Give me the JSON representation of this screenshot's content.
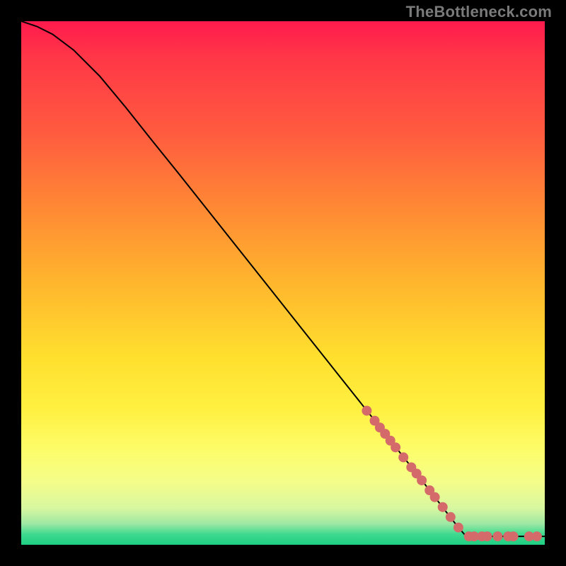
{
  "watermark": "TheBottleneck.com",
  "chart_data": {
    "type": "line",
    "title": "",
    "xlabel": "",
    "ylabel": "",
    "xlim": [
      0,
      100
    ],
    "ylim": [
      0,
      100
    ],
    "grid": false,
    "series": [
      {
        "name": "curve",
        "x": [
          0,
          3,
          6,
          10,
          15,
          20,
          25,
          30,
          35,
          40,
          45,
          50,
          55,
          60,
          65,
          70,
          74,
          78,
          81,
          83.5,
          85,
          90,
          95,
          100
        ],
        "y": [
          100,
          99,
          97.5,
          94.5,
          89.5,
          83.5,
          77.2,
          71.0,
          64.7,
          58.4,
          52.1,
          45.8,
          39.5,
          33.2,
          26.9,
          20.6,
          15.5,
          10.4,
          6.5,
          3.3,
          1.6,
          1.6,
          1.6,
          1.6
        ]
      }
    ],
    "markers": {
      "name": "highlighted-points",
      "color": "#d46a6a",
      "x": [
        66,
        67.5,
        68.5,
        69.5,
        70.5,
        71.5,
        73,
        74.5,
        75.5,
        76.5,
        78,
        79,
        80.5,
        82,
        83.5,
        85.5,
        86.5,
        88,
        89,
        91,
        93,
        94,
        97,
        98.5
      ],
      "y": [
        25.6,
        23.7,
        22.4,
        21.2,
        19.9,
        18.6,
        16.7,
        14.8,
        13.6,
        12.3,
        10.4,
        9.1,
        7.2,
        5.3,
        3.3,
        1.6,
        1.6,
        1.6,
        1.6,
        1.6,
        1.6,
        1.6,
        1.6,
        1.6
      ]
    },
    "gradient_stops": [
      {
        "pos": 0.0,
        "color": "#ff1a4d"
      },
      {
        "pos": 0.07,
        "color": "#ff3747"
      },
      {
        "pos": 0.22,
        "color": "#ff5d3f"
      },
      {
        "pos": 0.36,
        "color": "#ff8a34"
      },
      {
        "pos": 0.5,
        "color": "#ffb62d"
      },
      {
        "pos": 0.64,
        "color": "#ffdf2e"
      },
      {
        "pos": 0.74,
        "color": "#fff040"
      },
      {
        "pos": 0.82,
        "color": "#fdfd6a"
      },
      {
        "pos": 0.88,
        "color": "#f4fd89"
      },
      {
        "pos": 0.93,
        "color": "#d8f7a0"
      },
      {
        "pos": 0.96,
        "color": "#9de8a3"
      },
      {
        "pos": 0.98,
        "color": "#3ed98f"
      },
      {
        "pos": 1.0,
        "color": "#1fcf84"
      }
    ]
  }
}
